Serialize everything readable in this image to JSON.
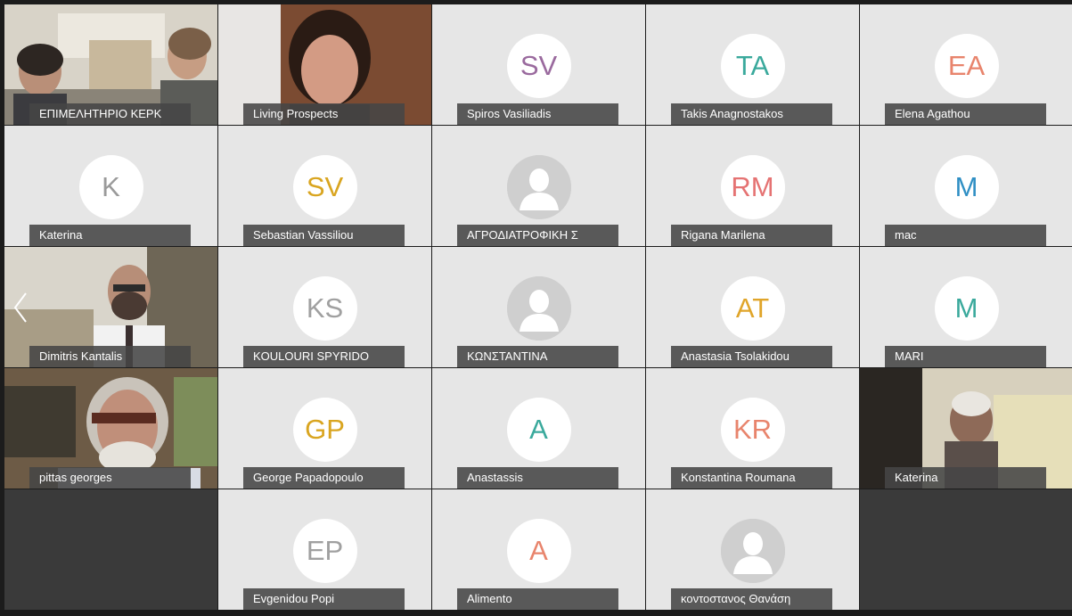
{
  "tiles": [
    {
      "name": "ΕΠΙΜΕΛΗΤΗΡΙΟ ΚΕΡΚ",
      "type": "video",
      "scene": "two-people-room"
    },
    {
      "name": "Living Prospects",
      "type": "video",
      "scene": "woman-closeup"
    },
    {
      "name": "Spiros Vasiliadis",
      "type": "avatar",
      "initials": "SV",
      "color": "#9a6a9e"
    },
    {
      "name": "Takis Anagnostakos",
      "type": "avatar",
      "initials": "TA",
      "color": "#3aa99c"
    },
    {
      "name": "Elena Agathou",
      "type": "avatar",
      "initials": "EA",
      "color": "#e8846c"
    },
    {
      "name": "Katerina",
      "type": "avatar",
      "initials": "K",
      "color": "#9a9a9a"
    },
    {
      "name": "Sebastian Vassiliou",
      "type": "avatar",
      "initials": "SV",
      "color": "#d9a520"
    },
    {
      "name": "ΑΓΡΟΔΙΑΤΡΟΦΙΚΗ Σ",
      "type": "silhouette"
    },
    {
      "name": "Rigana Marilena",
      "type": "avatar",
      "initials": "RM",
      "color": "#e57373"
    },
    {
      "name": "mac",
      "type": "avatar",
      "initials": "M",
      "color": "#2f8fc4"
    },
    {
      "name": "Dimitris Kantalis",
      "type": "video",
      "scene": "man-glasses"
    },
    {
      "name": "KOULOURI SPYRIDO",
      "type": "avatar",
      "initials": "KS",
      "color": "#a0a0a0"
    },
    {
      "name": "ΚΩΝΣΤΑΝΤΙΝΑ",
      "type": "silhouette"
    },
    {
      "name": "Anastasia Tsolakidou",
      "type": "avatar",
      "initials": "AT",
      "color": "#e0a52a"
    },
    {
      "name": "MARI",
      "type": "avatar",
      "initials": "M",
      "color": "#3aa99c"
    },
    {
      "name": "pittas georges",
      "type": "video",
      "scene": "man-white-hair"
    },
    {
      "name": "George Papadopoulo",
      "type": "avatar",
      "initials": "GP",
      "color": "#d9a520"
    },
    {
      "name": "Anastassis",
      "type": "avatar",
      "initials": "A",
      "color": "#3aa99c"
    },
    {
      "name": "Konstantina Roumana",
      "type": "avatar",
      "initials": "KR",
      "color": "#e8846c"
    },
    {
      "name": "Katerina",
      "type": "video",
      "scene": "man-looking-down"
    },
    {
      "name": "",
      "type": "empty"
    },
    {
      "name": "Evgenidou Popi",
      "type": "avatar",
      "initials": "EP",
      "color": "#a0a0a0"
    },
    {
      "name": "Alimento",
      "type": "avatar",
      "initials": "A",
      "color": "#e8846c"
    },
    {
      "name": "κοντοστανος Θανάση",
      "type": "silhouette"
    },
    {
      "name": "",
      "type": "empty"
    }
  ]
}
